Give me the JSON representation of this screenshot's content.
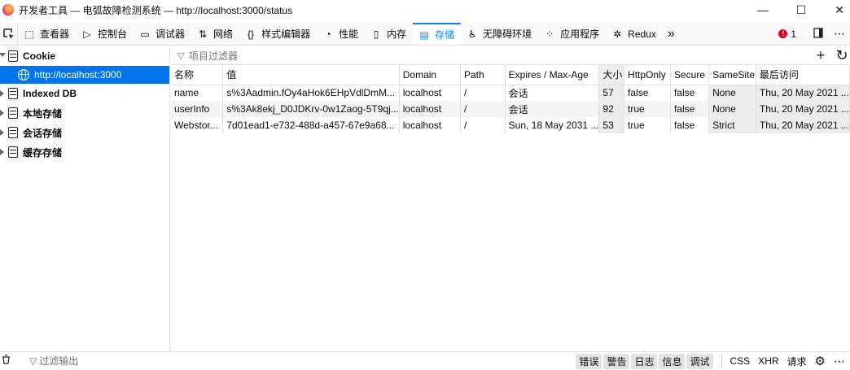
{
  "window": {
    "title": "开发者工具 — 电弧故障检测系统 — http://localhost:3000/status",
    "minimize": "—",
    "maximize": "☐",
    "close": "✕"
  },
  "toolbar": {
    "tabs": [
      {
        "label": "查看器",
        "icon": "inspector-icon",
        "glyph": "⬚"
      },
      {
        "label": "控制台",
        "icon": "console-icon",
        "glyph": "▷"
      },
      {
        "label": "调试器",
        "icon": "debugger-icon",
        "glyph": "▭"
      },
      {
        "label": "网络",
        "icon": "network-icon",
        "glyph": "⇅"
      },
      {
        "label": "样式编辑器",
        "icon": "style-editor-icon",
        "glyph": "{}"
      },
      {
        "label": "性能",
        "icon": "performance-icon",
        "glyph": "◔"
      },
      {
        "label": "内存",
        "icon": "memory-icon",
        "glyph": "▯"
      },
      {
        "label": "存储",
        "icon": "storage-icon",
        "glyph": "▤"
      },
      {
        "label": "无障碍环境",
        "icon": "accessibility-icon",
        "glyph": "♿"
      },
      {
        "label": "应用程序",
        "icon": "application-icon",
        "glyph": "⁘"
      },
      {
        "label": "Redux",
        "icon": "redux-icon",
        "glyph": "✲"
      }
    ],
    "active_tab": "存储",
    "more": "»",
    "error_count": "1",
    "accent_color": "#0a84ff"
  },
  "sidebar": {
    "items": [
      {
        "label": "Cookie",
        "expanded": true
      },
      {
        "label": "Indexed DB",
        "expanded": false
      },
      {
        "label": "本地存储",
        "expanded": false
      },
      {
        "label": "会话存储",
        "expanded": false
      },
      {
        "label": "缓存存储",
        "expanded": false
      }
    ],
    "selected_child": "http://localhost:3000"
  },
  "main": {
    "filter_placeholder": "项目过滤器",
    "add_label": "+",
    "refresh_label": "↻",
    "columns": [
      "名称",
      "值",
      "Domain",
      "Path",
      "Expires / Max-Age",
      "大小",
      "HttpOnly",
      "Secure",
      "SameSite",
      "最后访问"
    ],
    "rows": [
      [
        "name",
        "s%3Aadmin.fOy4aHok6EHpVdlDmM...",
        "localhost",
        "/",
        "会话",
        "57",
        "false",
        "false",
        "None",
        "Thu, 20 May 2021 ..."
      ],
      [
        "userInfo",
        "s%3Ak8ekj_D0JDKrv-0w1Zaog-5T9qj...",
        "localhost",
        "/",
        "会话",
        "92",
        "true",
        "false",
        "None",
        "Thu, 20 May 2021 ..."
      ],
      [
        "Webstor...",
        "7d01ead1-e732-488d-a457-67e9a68...",
        "localhost",
        "/",
        "Sun, 18 May 2031 ...",
        "53",
        "true",
        "false",
        "Strict",
        "Thu, 20 May 2021 ..."
      ]
    ]
  },
  "console": {
    "filter_placeholder": "过滤输出",
    "levels": [
      "错误",
      "警告",
      "日志",
      "信息",
      "调试"
    ],
    "types": [
      "CSS",
      "XHR",
      "请求"
    ]
  }
}
